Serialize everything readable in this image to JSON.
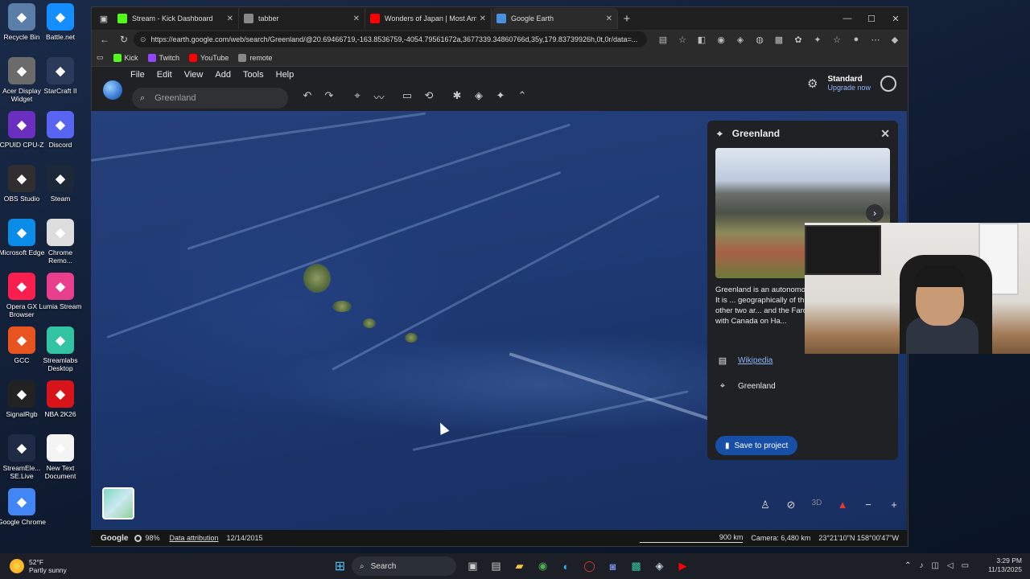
{
  "desktop_icons": [
    {
      "label": "Recycle Bin",
      "icon": "recycle-bin-icon",
      "color": "#5a7ea8"
    },
    {
      "label": "Battle.net",
      "icon": "battlenet-icon",
      "color": "#148eff"
    },
    {
      "label": "Acer Display Widget",
      "icon": "acer-display-icon",
      "color": "#6b6b6b"
    },
    {
      "label": "StarCraft II",
      "icon": "starcraft-icon",
      "color": "#2a3a5a"
    },
    {
      "label": "CPUID CPU-Z",
      "icon": "cpuz-icon",
      "color": "#6a2fbf"
    },
    {
      "label": "Discord",
      "icon": "discord-icon",
      "color": "#5865f2"
    },
    {
      "label": "OBS Studio",
      "icon": "obs-icon",
      "color": "#302e31"
    },
    {
      "label": "Steam",
      "icon": "steam-icon",
      "color": "#1b2838"
    },
    {
      "label": "Microsoft Edge",
      "icon": "edge-icon",
      "color": "#0c8ce9"
    },
    {
      "label": "Chrome Remo...",
      "icon": "chrome-remote-icon",
      "color": "#dddddd"
    },
    {
      "label": "Opera GX Browser",
      "icon": "opera-gx-icon",
      "color": "#fa1e4e"
    },
    {
      "label": "Lumia Stream",
      "icon": "lumia-icon",
      "color": "#e83e8c"
    },
    {
      "label": "GCC",
      "icon": "gcc-icon",
      "color": "#e8541f"
    },
    {
      "label": "Streamlabs Desktop",
      "icon": "streamlabs-icon",
      "color": "#31c3a2"
    },
    {
      "label": "SignalRgb",
      "icon": "signalrgb-icon",
      "color": "#222222"
    },
    {
      "label": "NBA 2K26",
      "icon": "nba2k-icon",
      "color": "#d7141a"
    },
    {
      "label": "StreamEle... SE.Live",
      "icon": "streamelements-icon",
      "color": "#1f2a44"
    },
    {
      "label": "New Text Document",
      "icon": "text-document-icon",
      "color": "#f4f4f4"
    },
    {
      "label": "Google Chrome",
      "icon": "chrome-icon",
      "color": "#4285f4"
    }
  ],
  "browser": {
    "tabs": [
      {
        "title": "Stream - Kick Dashboard",
        "icon": "kick-icon",
        "color": "#53fc18",
        "active": false
      },
      {
        "title": "tabber",
        "icon": "tab-icon",
        "color": "#888888",
        "active": false
      },
      {
        "title": "Wonders of Japan | Most Amazing",
        "icon": "youtube-icon",
        "color": "#ff0000",
        "active": false
      },
      {
        "title": "Google Earth",
        "icon": "google-earth-icon",
        "color": "#4a90e2",
        "active": true
      }
    ],
    "url": "https://earth.google.com/web/search/Greenland/@20.69466719,-163.8536759,-4054.79561672a,3677339.34860766d,35y,179.83739926h,0t,0r/data=...",
    "bookmarks": [
      {
        "label": "Kick",
        "color": "#53fc18"
      },
      {
        "label": "Twitch",
        "color": "#9146ff"
      },
      {
        "label": "YouTube",
        "color": "#ff0000"
      },
      {
        "label": "remote",
        "color": "#888888"
      }
    ]
  },
  "earth": {
    "menu": [
      "File",
      "Edit",
      "View",
      "Add",
      "Tools",
      "Help"
    ],
    "search_value": "Greenland",
    "plan": "Standard",
    "upgrade": "Upgrade now",
    "card": {
      "title": "Greenland",
      "description": "Greenland is an autonomo... Kingdom of Denmark. It is ... geographically of three co... kingdom; the other two ar... and the Faroe Islands. It sh... border with Canada on Ha...",
      "wiki_link": "Wikipedia",
      "place": "Greenland",
      "save_button": "Save to project"
    },
    "status": {
      "brand": "Google",
      "loading": "98%",
      "attribution": "Data attribution",
      "date": "12/14/2015",
      "scale": "900 km",
      "camera": "Camera: 6,480 km",
      "coords": "23°21'10\"N 158°00'47\"W"
    },
    "controls": {
      "three_d": "3D"
    }
  },
  "taskbar": {
    "temp": "52°F",
    "weather": "Partly sunny",
    "search": "Search",
    "time": "3:29 PM",
    "date": "11/13/2025"
  }
}
